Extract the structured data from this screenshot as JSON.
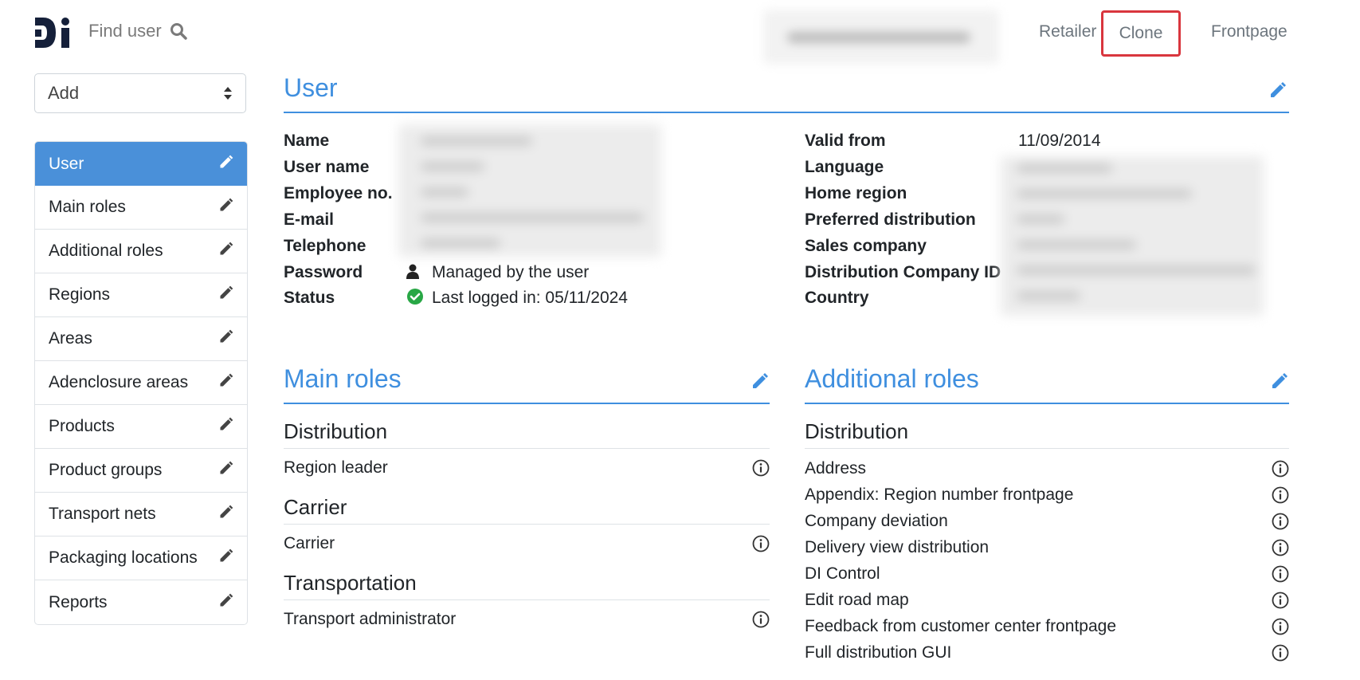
{
  "header": {
    "logo_text": "Di",
    "find_user": "Find user",
    "nav": {
      "retailer": "Retailer",
      "clone": "Clone",
      "frontpage": "Frontpage"
    }
  },
  "sidebar": {
    "add_select": "Add",
    "items": [
      {
        "label": "User",
        "active": true
      },
      {
        "label": "Main roles"
      },
      {
        "label": "Additional roles"
      },
      {
        "label": "Regions"
      },
      {
        "label": "Areas"
      },
      {
        "label": "Adenclosure areas"
      },
      {
        "label": "Products"
      },
      {
        "label": "Product groups"
      },
      {
        "label": "Transport nets"
      },
      {
        "label": "Packaging locations"
      },
      {
        "label": "Reports"
      }
    ]
  },
  "user_section": {
    "title": "User",
    "left_fields": {
      "name": "Name",
      "user_name": "User name",
      "employee_no": "Employee no.",
      "email": "E-mail",
      "telephone": "Telephone",
      "password": "Password",
      "password_value": "Managed by the user",
      "status": "Status",
      "status_value": "Last logged in: 05/11/2024"
    },
    "right_fields": {
      "valid_from": "Valid from",
      "valid_from_value": "11/09/2014",
      "language": "Language",
      "home_region": "Home region",
      "preferred_distribution": "Preferred distribution",
      "sales_company": "Sales company",
      "distribution_company_id": "Distribution Company ID",
      "country": "Country"
    }
  },
  "main_roles": {
    "title": "Main roles",
    "groups": [
      {
        "name": "Distribution",
        "roles": [
          "Region leader"
        ]
      },
      {
        "name": "Carrier",
        "roles": [
          "Carrier"
        ]
      },
      {
        "name": "Transportation",
        "roles": [
          "Transport administrator"
        ]
      }
    ]
  },
  "additional_roles": {
    "title": "Additional roles",
    "groups": [
      {
        "name": "Distribution",
        "roles": [
          "Address",
          "Appendix: Region number frontpage",
          "Company deviation",
          "Delivery view distribution",
          "DI Control",
          "Edit road map",
          "Feedback from customer center frontpage",
          "Full distribution GUI"
        ]
      }
    ]
  },
  "colors": {
    "accent": "#3f8fdf",
    "active_bg": "#4a90d9",
    "clone_highlight": "#d9363e",
    "status_ok": "#28a745"
  }
}
